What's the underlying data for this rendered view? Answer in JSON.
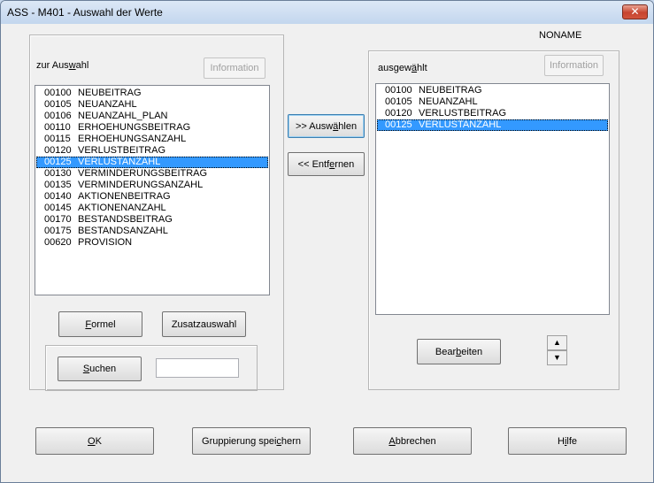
{
  "window": {
    "title": "ASS - M401 - Auswahl der Werte",
    "close_label": "✕"
  },
  "noname": "NONAME",
  "left": {
    "heading_pre": "zur Aus",
    "heading_u": "w",
    "heading_post": "ahl",
    "information_label": "Information",
    "items": [
      {
        "code": "00100",
        "name": "NEUBEITRAG",
        "selected": false
      },
      {
        "code": "00105",
        "name": "NEUANZAHL",
        "selected": false
      },
      {
        "code": "00106",
        "name": "NEUANZAHL_PLAN",
        "selected": false
      },
      {
        "code": "00110",
        "name": "ERHOEHUNGSBEITRAG",
        "selected": false
      },
      {
        "code": "00115",
        "name": "ERHOEHUNGSANZAHL",
        "selected": false
      },
      {
        "code": "00120",
        "name": "VERLUSTBEITRAG",
        "selected": false
      },
      {
        "code": "00125",
        "name": "VERLUSTANZAHL",
        "selected": true
      },
      {
        "code": "00130",
        "name": "VERMINDERUNGSBEITRAG",
        "selected": false
      },
      {
        "code": "00135",
        "name": "VERMINDERUNGSANZAHL",
        "selected": false
      },
      {
        "code": "00140",
        "name": "AKTIONENBEITRAG",
        "selected": false
      },
      {
        "code": "00145",
        "name": "AKTIONENANZAHL",
        "selected": false
      },
      {
        "code": "00170",
        "name": "BESTANDSBEITRAG",
        "selected": false
      },
      {
        "code": "00175",
        "name": "BESTANDSANZAHL",
        "selected": false
      },
      {
        "code": "00620",
        "name": "PROVISION",
        "selected": false
      }
    ],
    "formel_u": "F",
    "formel_rest": "ormel",
    "zusatz_label": "Zusatzauswahl",
    "suchen_u": "S",
    "suchen_rest": "uchen",
    "search_value": ""
  },
  "middle": {
    "auswaehlen_pre": ">> Ausw",
    "auswaehlen_u": "ä",
    "auswaehlen_post": "hlen",
    "entfernen_pre": "<< Entf",
    "entfernen_u": "e",
    "entfernen_post": "rnen"
  },
  "right": {
    "heading_pre": "ausgew",
    "heading_u": "ä",
    "heading_post": "hlt",
    "information_label": "Information",
    "items": [
      {
        "code": "00100",
        "name": "NEUBEITRAG",
        "selected": false
      },
      {
        "code": "00105",
        "name": "NEUANZAHL",
        "selected": false
      },
      {
        "code": "00120",
        "name": "VERLUSTBEITRAG",
        "selected": false
      },
      {
        "code": "00125",
        "name": "VERLUSTANZAHL",
        "selected": true
      }
    ],
    "bearbeiten_pre": "Bear",
    "bearbeiten_u": "b",
    "bearbeiten_post": "eiten",
    "up_arrow": "▲",
    "down_arrow": "▼"
  },
  "footer": {
    "ok_u": "O",
    "ok_rest": "K",
    "gruppierung_pre": "Gruppierung spei",
    "gruppierung_u": "c",
    "gruppierung_post": "hern",
    "abbrechen_u": "A",
    "abbrechen_rest": "bbrechen",
    "hilfe_pre": "H",
    "hilfe_u": "i",
    "hilfe_post": "lfe"
  }
}
